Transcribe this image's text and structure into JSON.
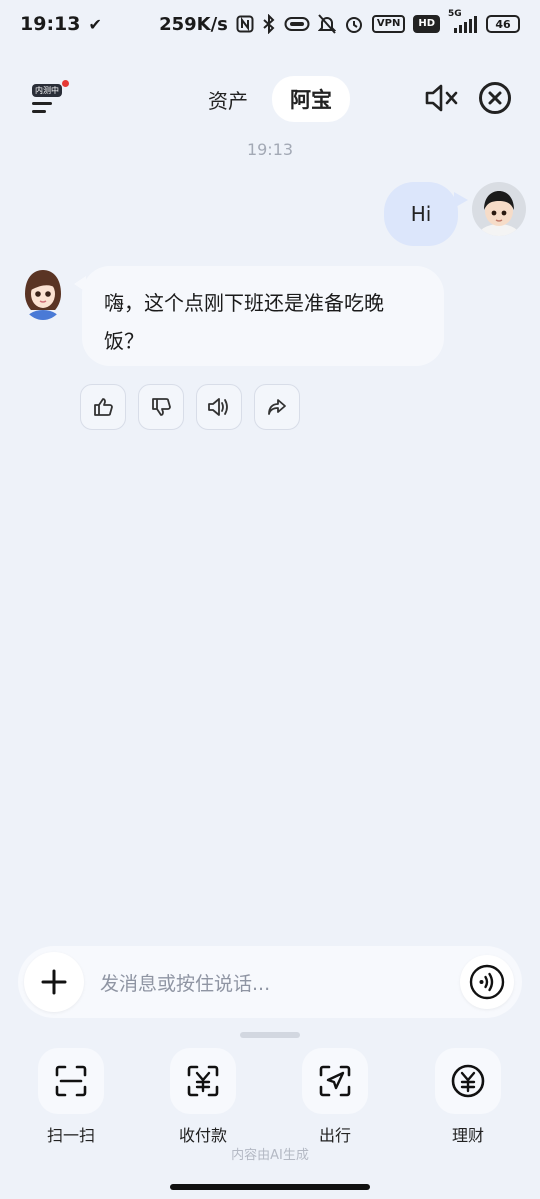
{
  "status_bar": {
    "time": "19:13",
    "speed": "259K/s",
    "vpn": "VPN",
    "hd": "HD",
    "network": "5G",
    "battery": "46"
  },
  "header": {
    "beta_badge": "内测中",
    "tabs": [
      {
        "label": "资产"
      },
      {
        "label": "阿宝"
      }
    ]
  },
  "chat": {
    "timestamp": "19:13",
    "user_message": "Hi",
    "ai_message": "嗨，这个点刚下班还是准备吃晚饭？"
  },
  "input": {
    "placeholder": "发消息或按住说话..."
  },
  "quick_actions": [
    {
      "label": "扫一扫",
      "icon": "scan-icon"
    },
    {
      "label": "收付款",
      "icon": "payment-icon"
    },
    {
      "label": "出行",
      "icon": "travel-icon"
    },
    {
      "label": "理财",
      "icon": "finance-icon"
    }
  ],
  "footer": {
    "disclaimer": "内容由AI生成"
  },
  "colors": {
    "background": "#eef2f9",
    "user_bubble": "#dce6fb",
    "ai_bubble": "#f6f8fc",
    "badge_dot": "#e53935"
  }
}
